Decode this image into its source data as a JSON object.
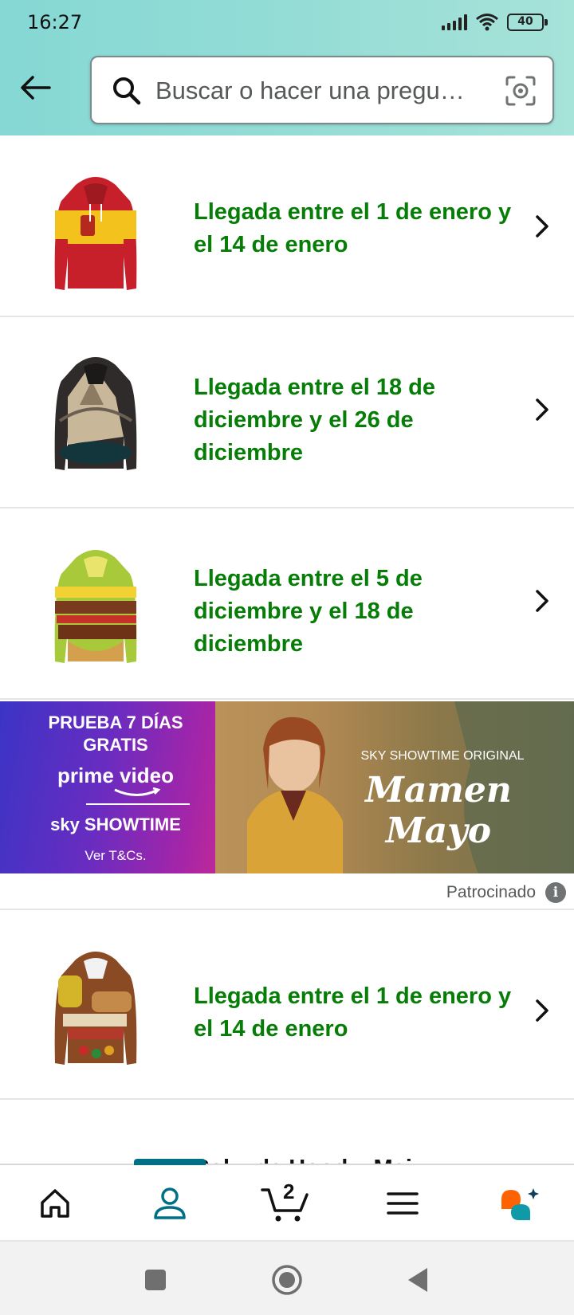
{
  "status_bar": {
    "time": "16:27",
    "battery": "40",
    "icons": [
      "signal-icon",
      "wifi-icon",
      "battery-icon"
    ]
  },
  "search": {
    "placeholder": "Buscar o hacer una pregu…",
    "icons": [
      "back-arrow-icon",
      "search-icon",
      "camera-lens-icon"
    ]
  },
  "results": [
    {
      "delivery": "Llegada entre el 1 de enero y el 14 de enero",
      "thumb": "spain-flag-hoodie"
    },
    {
      "delivery": "Llegada entre el 18 de diciembre y el 26 de diciembre",
      "thumb": "pyramid-hoodie"
    },
    {
      "delivery": "Llegada entre el 5 de diciembre y el 18 de diciembre",
      "thumb": "burger-hoodie"
    },
    {
      "delivery": "Llegada entre el 1 de enero y el 14 de enero",
      "thumb": "sandwich-hoodie"
    }
  ],
  "ad": {
    "line1": "PRUEBA 7 DÍAS",
    "line2": "GRATIS",
    "brand1": "prime video",
    "brand2": "sky SHOWTIME",
    "terms": "Ver T&Cs.",
    "kicker": "SKY SHOWTIME ORIGINAL",
    "show_title": "Mamen Mayo",
    "sponsored": "Patrocinado"
  },
  "partial_title": "Pol... de Hood... Mai...",
  "bottom_nav": {
    "items": [
      "home-icon",
      "account-icon",
      "cart-icon",
      "menu-icon",
      "rufus-icon"
    ],
    "cart_count": "2",
    "active": "account",
    "accent": "#007185"
  },
  "colors": {
    "delivery_green": "#067d06",
    "header_gradient_start": "#85d8d4",
    "header_gradient_end": "#a6e3d9"
  }
}
